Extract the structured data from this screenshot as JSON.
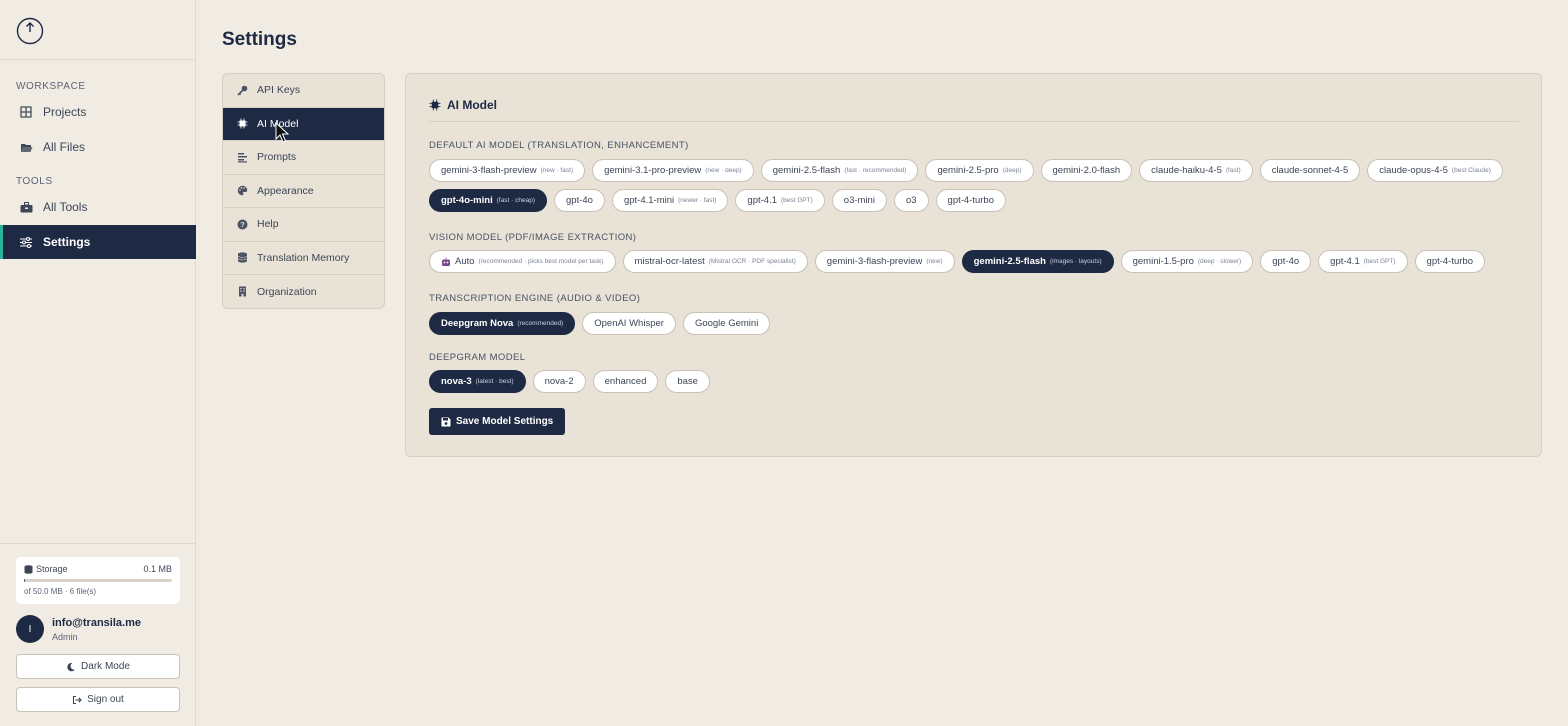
{
  "sidebar": {
    "sections": {
      "workspace": "WORKSPACE",
      "tools": "TOOLS"
    },
    "items": [
      {
        "label": "Projects",
        "icon": "grid-icon"
      },
      {
        "label": "All Files",
        "icon": "folder-open-icon"
      },
      {
        "label": "All Tools",
        "icon": "toolbox-icon"
      },
      {
        "label": "Settings",
        "icon": "sliders-icon"
      }
    ],
    "storage": {
      "label": "Storage",
      "used": "0.1 MB",
      "detail": "of 50.0 MB · 6 file(s)",
      "fraction": 0.002
    },
    "user": {
      "initial": "I",
      "email": "info@transila.me",
      "role": "Admin"
    },
    "dark_mode_label": "Dark Mode",
    "sign_out_label": "Sign out"
  },
  "page": {
    "title": "Settings"
  },
  "settings_nav": [
    {
      "label": "API Keys",
      "icon": "key-icon"
    },
    {
      "label": "AI Model",
      "icon": "chip-icon"
    },
    {
      "label": "Prompts",
      "icon": "list-icon"
    },
    {
      "label": "Appearance",
      "icon": "palette-icon"
    },
    {
      "label": "Help",
      "icon": "help-icon"
    },
    {
      "label": "Translation Memory",
      "icon": "database-icon"
    },
    {
      "label": "Organization",
      "icon": "building-icon"
    }
  ],
  "panel": {
    "title": "AI Model",
    "default_model": {
      "label": "DEFAULT AI MODEL (TRANSLATION, ENHANCEMENT)",
      "chips": [
        {
          "name": "gemini-3-flash-preview",
          "tag": "(new · fast)"
        },
        {
          "name": "gemini-3.1-pro-preview",
          "tag": "(new · deep)"
        },
        {
          "name": "gemini-2.5-flash",
          "tag": "(fast · recommended)"
        },
        {
          "name": "gemini-2.5-pro",
          "tag": "(deep)"
        },
        {
          "name": "gemini-2.0-flash",
          "tag": ""
        },
        {
          "name": "claude-haiku-4-5",
          "tag": "(fast)"
        },
        {
          "name": "claude-sonnet-4-5",
          "tag": ""
        },
        {
          "name": "claude-opus-4-5",
          "tag": "(best Claude)"
        },
        {
          "name": "gpt-4o-mini",
          "tag": "(fast · cheap)"
        },
        {
          "name": "gpt-4o",
          "tag": ""
        },
        {
          "name": "gpt-4.1-mini",
          "tag": "(newer · fast)"
        },
        {
          "name": "gpt-4.1",
          "tag": "(best GPT)"
        },
        {
          "name": "o3-mini",
          "tag": ""
        },
        {
          "name": "o3",
          "tag": ""
        },
        {
          "name": "gpt-4-turbo",
          "tag": ""
        }
      ]
    },
    "vision_model": {
      "label": "VISION MODEL (PDF/IMAGE EXTRACTION)",
      "chips": [
        {
          "name": "Auto",
          "tag": "(recommended · picks best model per task)"
        },
        {
          "name": "mistral-ocr-latest",
          "tag": "(Mistral OCR · PDF specialist)"
        },
        {
          "name": "gemini-3-flash-preview",
          "tag": "(new)"
        },
        {
          "name": "gemini-2.5-flash",
          "tag": "(images · layouts)"
        },
        {
          "name": "gemini-1.5-pro",
          "tag": "(deep · slower)"
        },
        {
          "name": "gpt-4o",
          "tag": ""
        },
        {
          "name": "gpt-4.1",
          "tag": "(best GPT)"
        },
        {
          "name": "gpt-4-turbo",
          "tag": ""
        }
      ]
    },
    "transcription": {
      "label": "TRANSCRIPTION ENGINE (AUDIO & VIDEO)",
      "chips": [
        {
          "name": "Deepgram Nova",
          "tag": "(recommended)"
        },
        {
          "name": "OpenAI Whisper",
          "tag": ""
        },
        {
          "name": "Google Gemini",
          "tag": ""
        }
      ]
    },
    "deepgram": {
      "label": "DEEPGRAM MODEL",
      "chips": [
        {
          "name": "nova-3",
          "tag": "(latest · best)"
        },
        {
          "name": "nova-2",
          "tag": ""
        },
        {
          "name": "enhanced",
          "tag": ""
        },
        {
          "name": "base",
          "tag": ""
        }
      ]
    },
    "save_label": "Save Model Settings"
  }
}
